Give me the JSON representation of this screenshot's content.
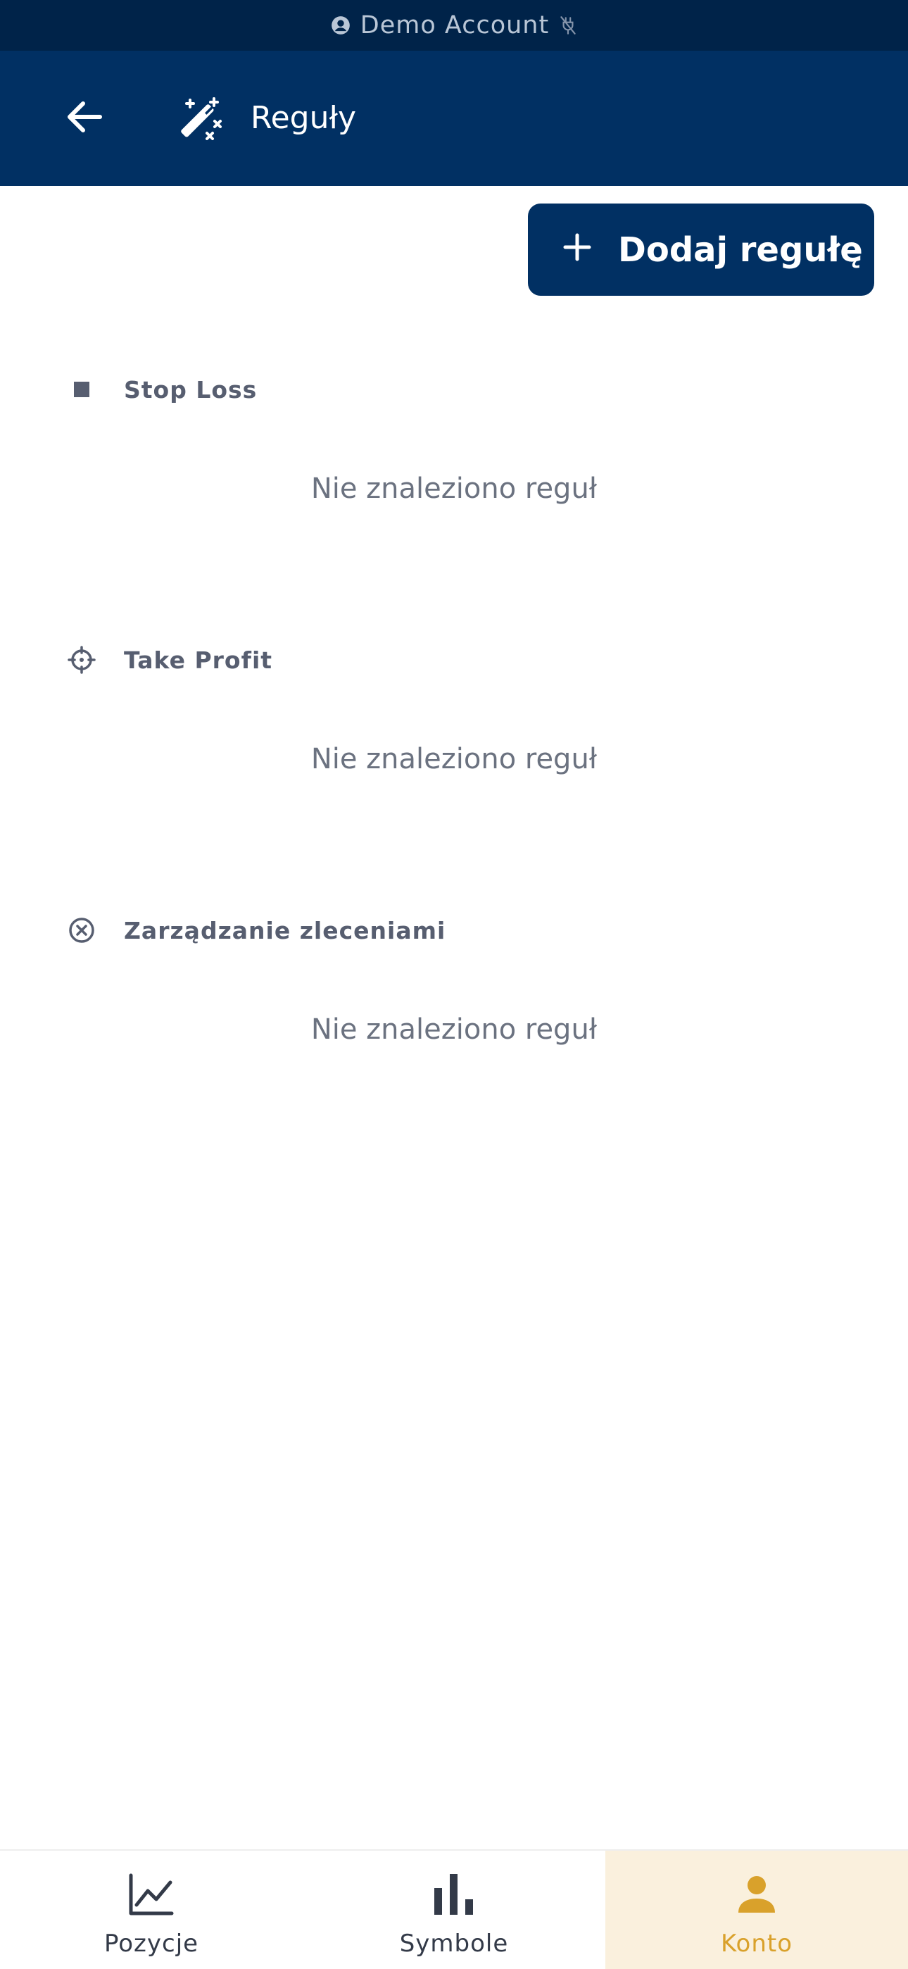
{
  "status_strip": {
    "label": "Demo Account"
  },
  "appbar": {
    "title": "Reguły"
  },
  "add_button": {
    "label": "Dodaj regułę"
  },
  "sections": [
    {
      "title": "Stop Loss",
      "icon": "square-icon",
      "empty_message": "Nie znaleziono reguł"
    },
    {
      "title": "Take Profit",
      "icon": "crosshair-icon",
      "empty_message": "Nie znaleziono reguł"
    },
    {
      "title": "Zarządzanie zleceniami",
      "icon": "x-circle-icon",
      "empty_message": "Nie znaleziono reguł"
    }
  ],
  "bottom_nav": {
    "items": [
      {
        "label": "Pozycje",
        "icon": "line-chart-icon",
        "active": false
      },
      {
        "label": "Symbole",
        "icon": "bar-chart-icon",
        "active": false
      },
      {
        "label": "Konto",
        "icon": "user-icon",
        "active": true
      }
    ]
  },
  "colors": {
    "strip_bg": "#002349",
    "appbar_bg": "#013063",
    "accent": "#d9a12b",
    "active_nav_bg": "#faf0dd"
  }
}
